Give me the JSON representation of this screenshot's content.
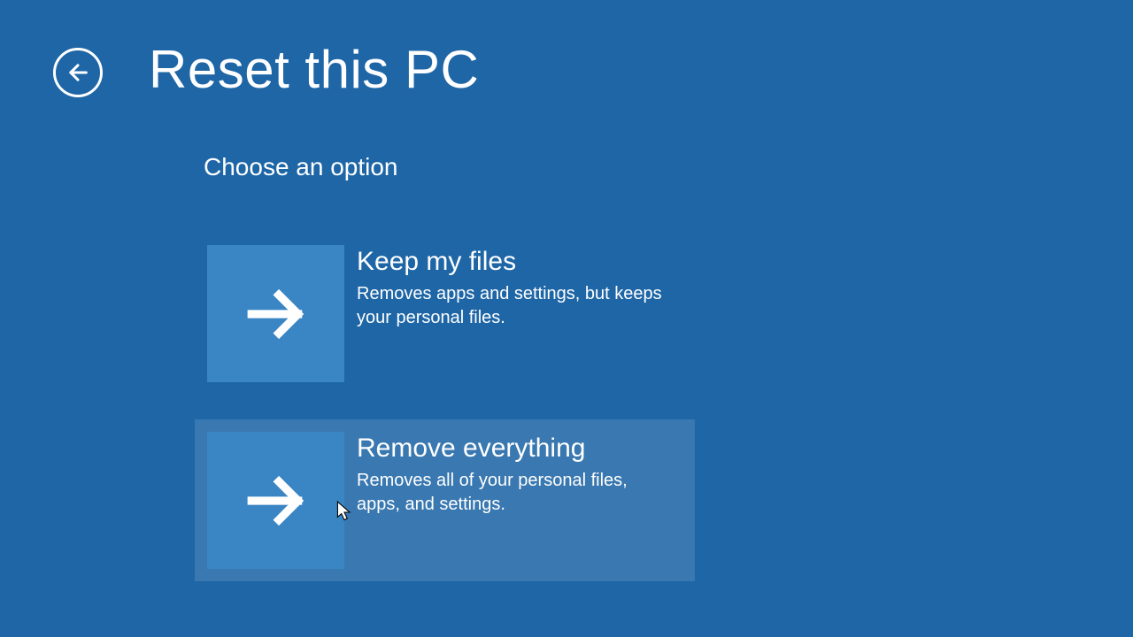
{
  "header": {
    "title": "Reset this PC"
  },
  "subtitle": "Choose an option",
  "options": [
    {
      "title": "Keep my files",
      "desc": "Removes apps and settings, but keeps your personal files."
    },
    {
      "title": "Remove everything",
      "desc": "Removes all of your personal files, apps, and settings."
    }
  ],
  "colors": {
    "background": "#1e66a6",
    "tile": "#3a86c4",
    "hover": "rgba(255,255,255,0.12)"
  }
}
